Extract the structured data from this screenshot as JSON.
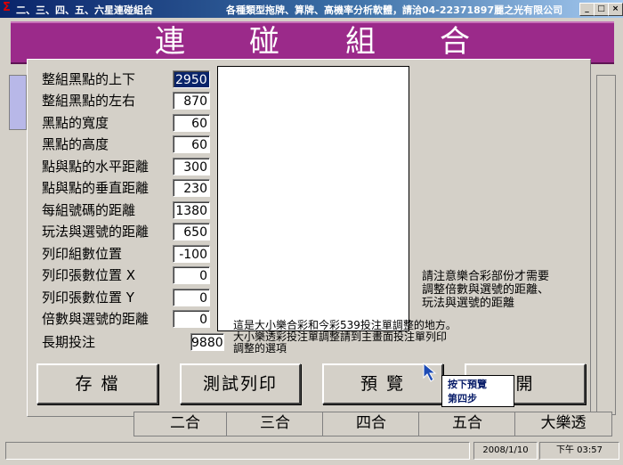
{
  "window": {
    "title_left": "二、三、四、五、六星連碰組合",
    "title_center": "各種類型拖牌、算牌、高機率分析軟體，請洽04-22371897麗之光有限公司",
    "buttons": [
      "_",
      "□",
      "×"
    ]
  },
  "banner": {
    "chars": [
      "連",
      "碰",
      "組",
      "合"
    ]
  },
  "fields": [
    {
      "label": "整組黑點的上下",
      "value": "2950"
    },
    {
      "label": "整組黑點的左右",
      "value": "870"
    },
    {
      "label": "黑點的寬度",
      "value": "60"
    },
    {
      "label": "黑點的高度",
      "value": "60"
    },
    {
      "label": "點與點的水平距離",
      "value": "300"
    },
    {
      "label": "點與點的垂直距離",
      "value": "230"
    },
    {
      "label": "每組號碼的距離",
      "value": "1380"
    },
    {
      "label": "玩法與選號的距離",
      "value": "650"
    },
    {
      "label": "列印組數位置",
      "value": "-100"
    },
    {
      "label": "列印張數位置 X",
      "value": "0"
    },
    {
      "label": "列印張數位置 Y",
      "value": "0"
    },
    {
      "label": "倍數與選號的距離",
      "value": "0"
    },
    {
      "label": "長期投注",
      "value": "9880"
    }
  ],
  "notes": {
    "right": [
      "請注意樂合彩部份才需要",
      "調整倍數與選號的距離、",
      "玩法與選號的距離"
    ],
    "bottom": [
      "這是大小樂合彩和今彩539投注單調整的地方。",
      "大小樂透彩投注單調整請到主畫面投注單列印",
      "調整的選項"
    ]
  },
  "buttons": {
    "save": "存 檔",
    "test_print": "測試列印",
    "preview": "預 覽",
    "leave": "開"
  },
  "tooltip": [
    "按下預覽",
    "第四步"
  ],
  "tabs": [
    "二合",
    "三合",
    "四合",
    "五合",
    "大樂透"
  ],
  "status": {
    "date": "2008/1/10",
    "time": "下午 03:57"
  },
  "colors": {
    "banner": "#9b2a8a",
    "titlebar": "#0a246a"
  }
}
